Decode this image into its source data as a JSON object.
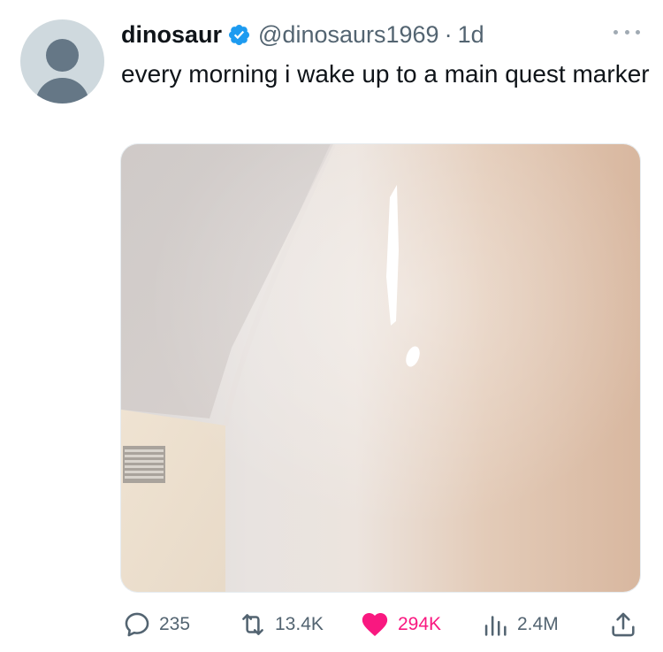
{
  "tweet": {
    "author_name": "dinosaur",
    "handle": "@dinosaurs1969",
    "separator": "·",
    "timestamp": "1d",
    "text": "every morning i wake up to a main quest marker"
  },
  "icons": {
    "avatar": "default-avatar",
    "verified": "verified-badge-icon",
    "more": "more-options-icon",
    "reply": "reply-icon",
    "retweet": "retweet-icon",
    "like": "heart-icon",
    "views": "views-chart-icon",
    "share": "share-icon"
  },
  "stats": {
    "replies": "235",
    "retweets": "13.4K",
    "likes": "294K",
    "views": "2.4M"
  },
  "colors": {
    "verified": "#1d9bf0",
    "like_active": "#f91880",
    "secondary_text": "#536471",
    "primary_text": "#0f1419"
  },
  "state": {
    "liked": true
  }
}
